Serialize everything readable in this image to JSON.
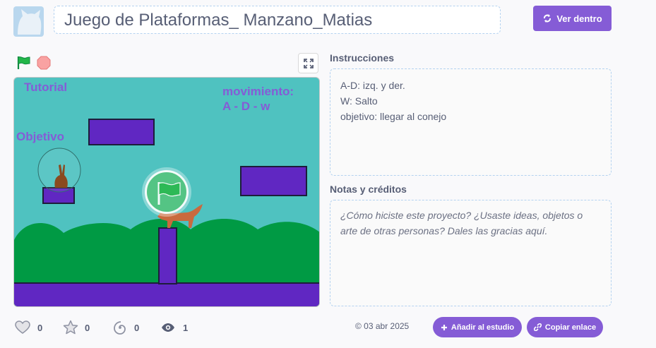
{
  "header": {
    "title": "Juego de Plataformas_ Manzano_Matias",
    "see_inside_label": "Ver dentro"
  },
  "stage": {
    "tutorial_label": "Tutorial",
    "objective_label": "Objetivo",
    "movement_label_line1": "movimiento:",
    "movement_label_line2": "A - D - w"
  },
  "instructions": {
    "heading": "Instrucciones",
    "lines": [
      "A-D: izq. y der.",
      "W: Salto",
      "objetivo: llegar al conejo"
    ]
  },
  "notes": {
    "heading": "Notas y créditos",
    "placeholder": "¿Cómo hiciste este proyecto? ¿Usaste ideas, objetos o arte de otras personas? Dales las gracias aquí."
  },
  "stats": {
    "loves": "0",
    "favorites": "0",
    "remixes": "0",
    "views": "1"
  },
  "footer": {
    "date": "© 03 abr 2025",
    "add_studio_label": "Añadir al estudio",
    "copy_link_label": "Copiar enlace"
  },
  "colors": {
    "accent": "#855cd6",
    "stage_sky": "#4fc2c0",
    "stage_hills": "#009a44",
    "stage_ground": "#6027c2"
  }
}
